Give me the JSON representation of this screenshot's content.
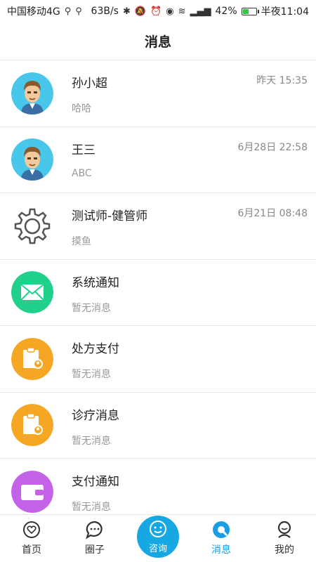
{
  "status_bar": {
    "carrier": "中国移动4G",
    "speed": "63B/s",
    "battery_percent": "42%",
    "time": "半夜11:04"
  },
  "header": {
    "title": "消息"
  },
  "messages": [
    {
      "name": "孙小超",
      "time": "昨天 15:35",
      "preview": "哈哈",
      "icon": "male-avatar"
    },
    {
      "name": "王三",
      "time": "6月28日 22:58",
      "preview": "ABC",
      "icon": "male-avatar"
    },
    {
      "name": "测试师-健管师",
      "time": "6月21日 08:48",
      "preview": "摸鱼",
      "icon": "gear"
    },
    {
      "name": "系统通知",
      "time": "",
      "preview": "暂无消息",
      "icon": "mail",
      "color": "#1fd18a"
    },
    {
      "name": "处方支付",
      "time": "",
      "preview": "暂无消息",
      "icon": "clipboard",
      "color": "#f5a623"
    },
    {
      "name": "诊疗消息",
      "time": "",
      "preview": "暂无消息",
      "icon": "clipboard",
      "color": "#f5a623"
    },
    {
      "name": "支付通知",
      "time": "",
      "preview": "暂无消息",
      "icon": "wallet",
      "color": "#c462e8"
    }
  ],
  "tabbar": {
    "tabs": [
      {
        "label": "首页",
        "icon": "heart-circle-icon"
      },
      {
        "label": "圈子",
        "icon": "chat-bubble-icon"
      },
      {
        "label": "咨询",
        "icon": "smile-icon"
      },
      {
        "label": "消息",
        "icon": "message-icon"
      },
      {
        "label": "我的",
        "icon": "person-icon"
      }
    ],
    "active_color": "#1a9ee3",
    "center_color": "#17a8e3"
  }
}
